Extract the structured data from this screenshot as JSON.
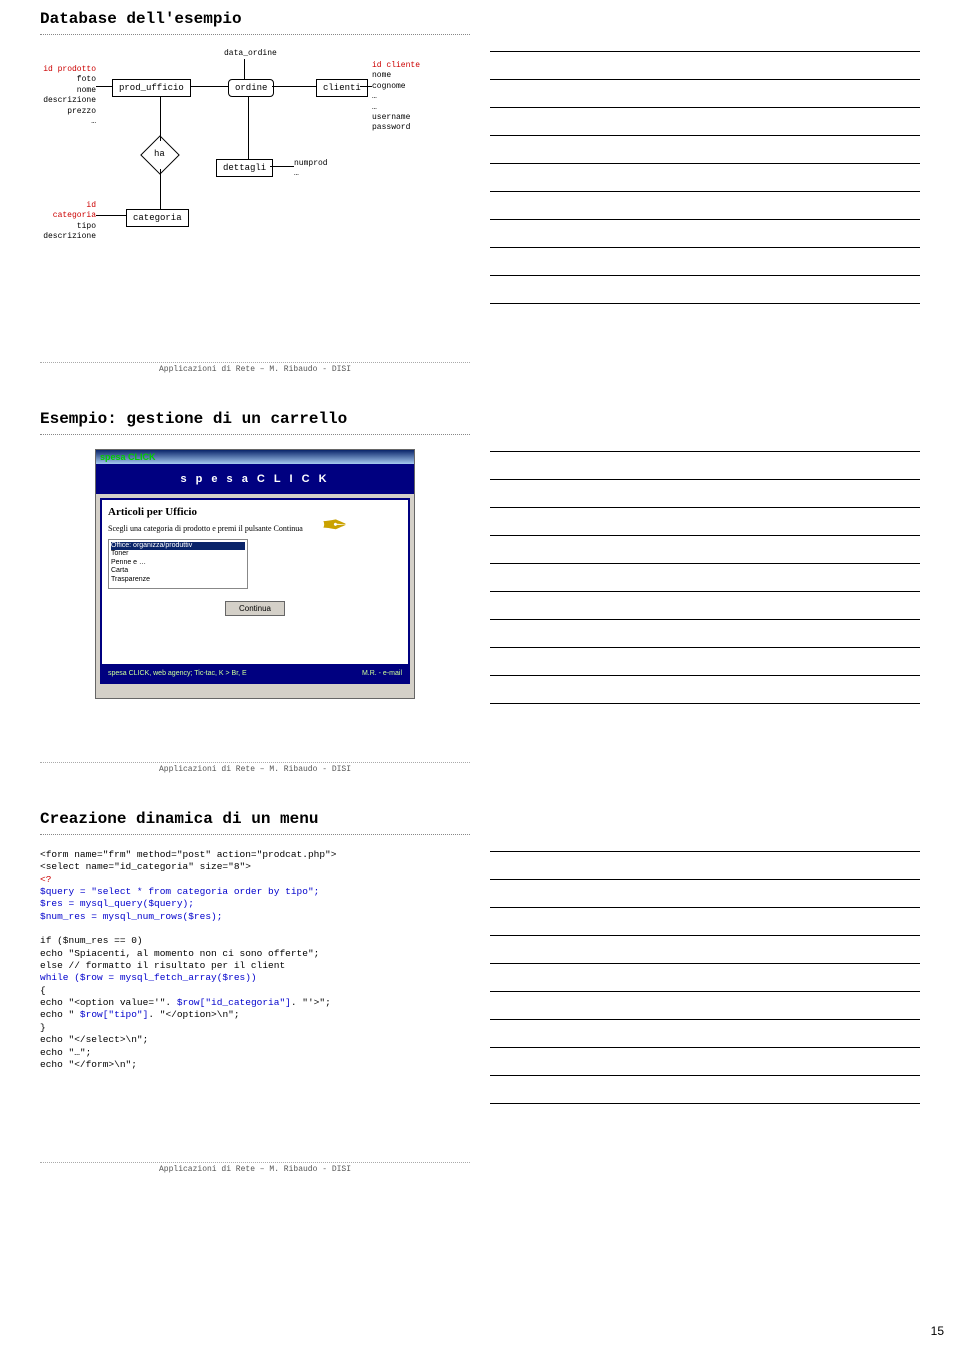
{
  "page_number": "15",
  "footer_text": "Applicazioni di Rete – M. Ribaudo - DISI",
  "slides": [
    {
      "title": "Database dell'esempio",
      "er": {
        "entities": {
          "prod_ufficio": "prod_ufficio",
          "ordine": "ordine",
          "clienti": "clienti",
          "categoria": "categoria"
        },
        "relations": {
          "dettagli": "dettagli",
          "ha": "ha"
        },
        "attrs": {
          "prodotto": {
            "items": [
              "id prodotto",
              "foto",
              "nome",
              "descrizione",
              "prezzo",
              "…"
            ],
            "red_idx": 0
          },
          "ordine_top": {
            "items": [
              "data_ordine"
            ]
          },
          "cliente": {
            "items": [
              "id cliente",
              "nome",
              "cognome",
              "…",
              "…",
              "username",
              "password"
            ],
            "red_idx": 0
          },
          "dettagli": {
            "items": [
              "numprod",
              "…"
            ]
          },
          "categoria": {
            "items": [
              "id categoria",
              "tipo",
              "descrizione"
            ],
            "red_idx": 0
          }
        }
      }
    },
    {
      "title": "Esempio: gestione di un carrello",
      "window": {
        "logo": "spesa CLICK",
        "banner": "s p e s a   C L I C K",
        "heading": "Articoli per Ufficio",
        "prompt": "Scegli una categoria di prodotto e premi il pulsante Continua",
        "options": [
          "Office: organizza/produttiv",
          "Toner",
          "Penne e …",
          "Carta",
          "Trasparenze"
        ],
        "selected": 0,
        "button": "Continua",
        "footer_left": "spesa CLICK, web agency; Tic-tac, K > Br, E",
        "footer_right": "M.R. - e-mail"
      }
    },
    {
      "title": "Creazione dinamica di un menu",
      "code": [
        {
          "t": "<form name=\"frm\" method=\"post\" action=\"prodcat.php\">",
          "c": "black"
        },
        {
          "t": "<select name=\"id_categoria\" size=\"8\">",
          "c": "black"
        },
        {
          "t": "<?",
          "c": "red"
        },
        {
          "t": "$query = \"select * from categoria order by tipo\";",
          "c": "blue"
        },
        {
          "t": "$res = mysql_query($query);",
          "c": "blue"
        },
        {
          "t": "$num_res = mysql_num_rows($res);",
          "c": "blue"
        },
        {
          "t": "",
          "c": "black"
        },
        {
          "t": "if ($num_res == 0)",
          "c": "black"
        },
        {
          "t": "    echo \"Spiacenti, al momento non ci sono offerte\";",
          "c": "black"
        },
        {
          "t": "else   // formatto il risultato per il client",
          "c": "black"
        },
        {
          "t": " while ($row = mysql_fetch_array($res))",
          "c": "blue"
        },
        {
          "t": "  {",
          "c": "black"
        },
        {
          "t": "   echo \"<option value='\". $row[\"id_categoria\"]. \"'>\";",
          "c": "black",
          "hl": [
            "$row[\"id_categoria\"]"
          ]
        },
        {
          "t": "   echo \" $row[\"tipo\"]. \"</option>\\n\";",
          "c": "black",
          "hl": [
            "$row[\"tipo\"]"
          ]
        },
        {
          "t": "  }",
          "c": "black"
        },
        {
          "t": "echo \"</select>\\n\";",
          "c": "black"
        },
        {
          "t": "echo \"…\";",
          "c": "black"
        },
        {
          "t": "echo \"</form>\\n\";",
          "c": "black"
        }
      ]
    }
  ]
}
